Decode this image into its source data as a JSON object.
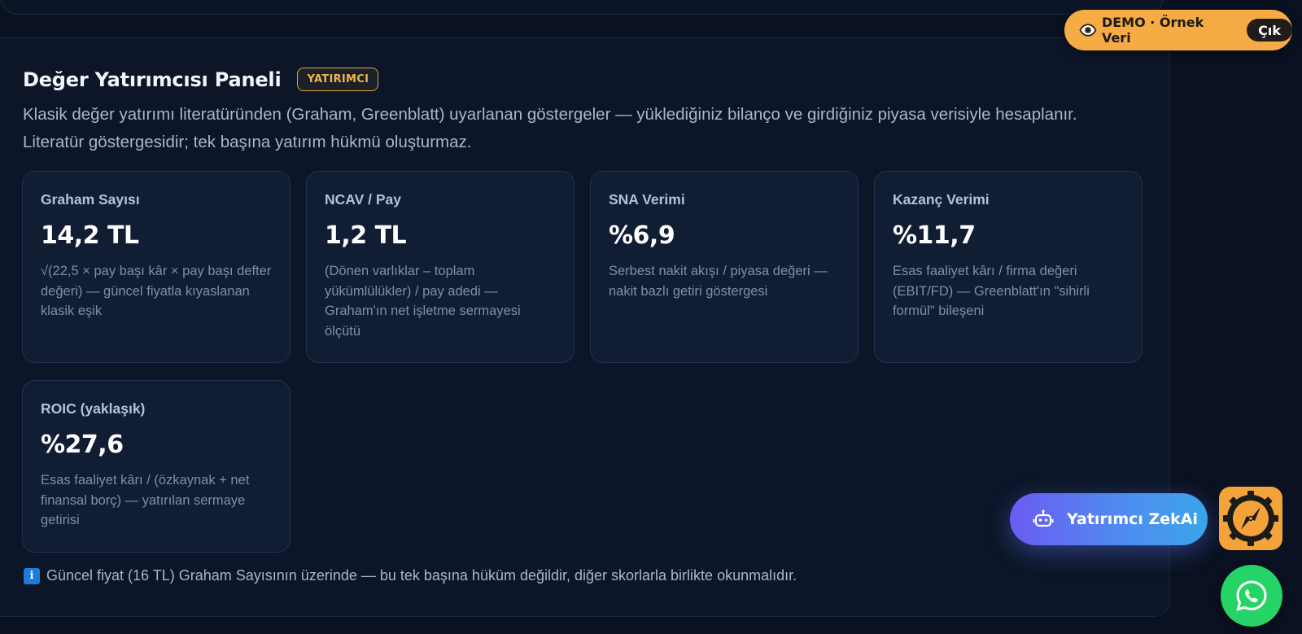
{
  "panel": {
    "title": "Değer Yatırımcısı Paneli",
    "badge": "YATIRIMCI",
    "description": "Klasik değer yatırımı literatüründen (Graham, Greenblatt) uyarlanan göstergeler — yüklediğiniz bilanço ve girdiğiniz piyasa verisiyle hesaplanır. Literatür göstergesidir; tek başına yatırım hükmü oluşturmaz."
  },
  "cards": [
    {
      "label": "Graham Sayısı",
      "value": "14,2 TL",
      "note": "√(22,5 × pay başı kâr × pay başı defter değeri) — güncel fiyatla kıyaslanan klasik eşik"
    },
    {
      "label": "NCAV / Pay",
      "value": "1,2 TL",
      "note": "(Dönen varlıklar – toplam yükümlülükler) / pay adedi — Graham'ın net işletme sermayesi ölçütü"
    },
    {
      "label": "SNA Verimi",
      "value": "%6,9",
      "note": "Serbest nakit akışı / piyasa değeri — nakit bazlı getiri göstergesi"
    },
    {
      "label": "Kazanç Verimi",
      "value": "%11,7",
      "note": "Esas faaliyet kârı / firma değeri (EBIT/FD) — Greenblatt'ın \"sihirli formül\" bileşeni"
    },
    {
      "label": "ROIC (yaklaşık)",
      "value": "%27,6",
      "note": "Esas faaliyet kârı / (özkaynak + net finansal borç) — yatırılan sermaye getirisi"
    }
  ],
  "footnote": {
    "icon": "info-icon",
    "text": "Güncel fiyat (16 TL) Graham Sayısının üzerinde — bu tek başına hüküm değildir, diğer skorlarla birlikte okunmalıdır."
  },
  "demo": {
    "text": "DEMO · Örnek Veri",
    "exit_label": "Çık",
    "icon": "eye-icon",
    "color": "#f6ab45"
  },
  "assistant": {
    "label": "Yatırımcı ZekAi",
    "icon": "robot-icon"
  },
  "colors": {
    "background": "#0a1120",
    "card": "#111d33",
    "accent": "#f2b54a",
    "whatsapp": "#25d366"
  }
}
